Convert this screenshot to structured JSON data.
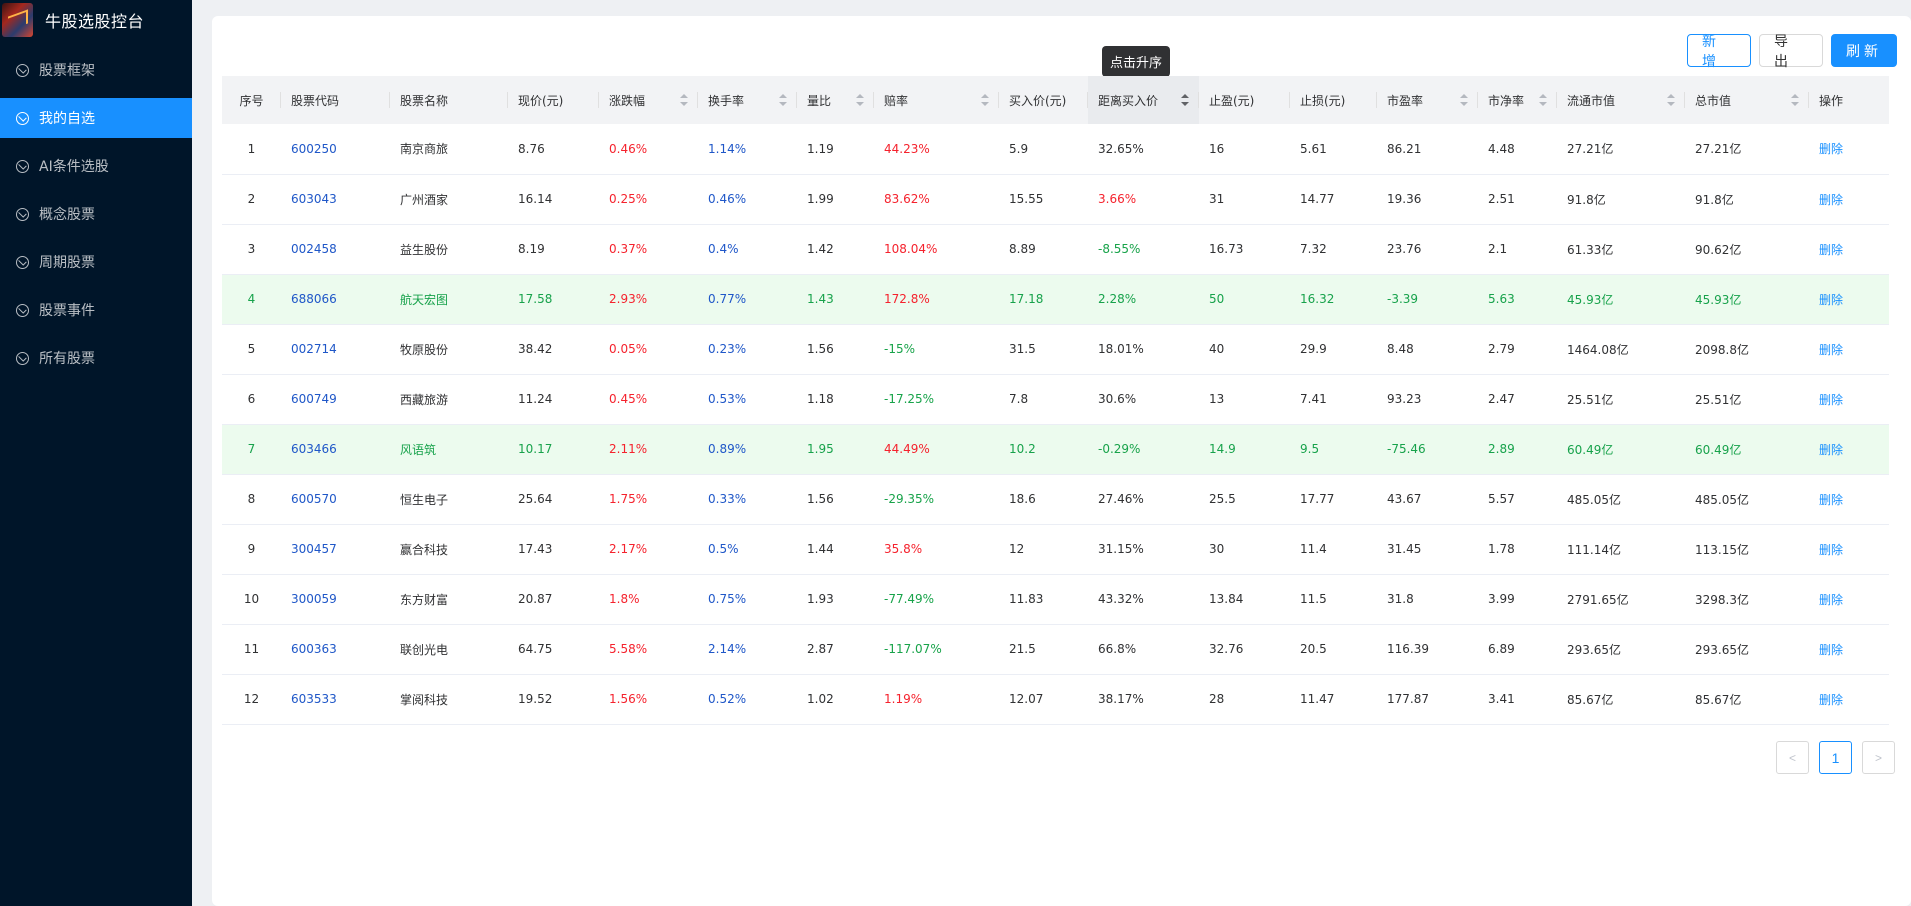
{
  "app": {
    "title": "牛股选股控台"
  },
  "sidebar": {
    "items": [
      {
        "label": "股票框架",
        "active": false
      },
      {
        "label": "我的自选",
        "active": true
      },
      {
        "label": "AI条件选股",
        "active": false
      },
      {
        "label": "概念股票",
        "active": false
      },
      {
        "label": "周期股票",
        "active": false
      },
      {
        "label": "股票事件",
        "active": false
      },
      {
        "label": "所有股票",
        "active": false
      }
    ]
  },
  "toolbar": {
    "add_label": "新增",
    "export_label": "导出",
    "refresh_label": "刷新"
  },
  "tooltip": {
    "text": "点击升序"
  },
  "colors": {
    "accent": "#1890ff",
    "sidebar_bg": "#001529",
    "rise": "#f5222d",
    "fall": "#18a34a",
    "link": "#1f57c8",
    "highlight_row": "#ecfbee"
  },
  "table": {
    "columns": [
      {
        "label": "序号",
        "sortable": false
      },
      {
        "label": "股票代码",
        "sortable": false
      },
      {
        "label": "股票名称",
        "sortable": false
      },
      {
        "label": "现价(元)",
        "sortable": false
      },
      {
        "label": "涨跌幅",
        "sortable": true
      },
      {
        "label": "换手率",
        "sortable": true
      },
      {
        "label": "量比",
        "sortable": true
      },
      {
        "label": "赔率",
        "sortable": true
      },
      {
        "label": "买入价(元)",
        "sortable": false
      },
      {
        "label": "距离买入价",
        "sortable": true
      },
      {
        "label": "止盈(元)",
        "sortable": false
      },
      {
        "label": "止损(元)",
        "sortable": false
      },
      {
        "label": "市盈率",
        "sortable": true
      },
      {
        "label": "市净率",
        "sortable": true
      },
      {
        "label": "流通市值",
        "sortable": true
      },
      {
        "label": "总市值",
        "sortable": true
      },
      {
        "label": "操作",
        "sortable": false
      }
    ],
    "action_label": "删除",
    "rows": [
      {
        "idx": "1",
        "code": "600250",
        "name": "南京商旅",
        "price": "8.76",
        "change": "0.46%",
        "turnover": "1.14%",
        "vol_ratio": "1.19",
        "odds": "44.23%",
        "buy": "5.9",
        "dist": "32.65%",
        "tp": "16",
        "sl": "5.61",
        "pe": "86.21",
        "pb": "4.48",
        "float_cap": "27.21亿",
        "total_cap": "27.21亿",
        "highlight": false
      },
      {
        "idx": "2",
        "code": "603043",
        "name": "广州酒家",
        "price": "16.14",
        "change": "0.25%",
        "turnover": "0.46%",
        "vol_ratio": "1.99",
        "odds": "83.62%",
        "buy": "15.55",
        "dist": "3.66%",
        "tp": "31",
        "sl": "14.77",
        "pe": "19.36",
        "pb": "2.51",
        "float_cap": "91.8亿",
        "total_cap": "91.8亿",
        "highlight": false
      },
      {
        "idx": "3",
        "code": "002458",
        "name": "益生股份",
        "price": "8.19",
        "change": "0.37%",
        "turnover": "0.4%",
        "vol_ratio": "1.42",
        "odds": "108.04%",
        "buy": "8.89",
        "dist": "-8.55%",
        "tp": "16.73",
        "sl": "7.32",
        "pe": "23.76",
        "pb": "2.1",
        "float_cap": "61.33亿",
        "total_cap": "90.62亿",
        "highlight": false
      },
      {
        "idx": "4",
        "code": "688066",
        "name": "航天宏图",
        "price": "17.58",
        "change": "2.93%",
        "turnover": "0.77%",
        "vol_ratio": "1.43",
        "odds": "172.8%",
        "buy": "17.18",
        "dist": "2.28%",
        "tp": "50",
        "sl": "16.32",
        "pe": "-3.39",
        "pb": "5.63",
        "float_cap": "45.93亿",
        "total_cap": "45.93亿",
        "highlight": true
      },
      {
        "idx": "5",
        "code": "002714",
        "name": "牧原股份",
        "price": "38.42",
        "change": "0.05%",
        "turnover": "0.23%",
        "vol_ratio": "1.56",
        "odds": "-15%",
        "buy": "31.5",
        "dist": "18.01%",
        "tp": "40",
        "sl": "29.9",
        "pe": "8.48",
        "pb": "2.79",
        "float_cap": "1464.08亿",
        "total_cap": "2098.8亿",
        "highlight": false
      },
      {
        "idx": "6",
        "code": "600749",
        "name": "西藏旅游",
        "price": "11.24",
        "change": "0.45%",
        "turnover": "0.53%",
        "vol_ratio": "1.18",
        "odds": "-17.25%",
        "buy": "7.8",
        "dist": "30.6%",
        "tp": "13",
        "sl": "7.41",
        "pe": "93.23",
        "pb": "2.47",
        "float_cap": "25.51亿",
        "total_cap": "25.51亿",
        "highlight": false
      },
      {
        "idx": "7",
        "code": "603466",
        "name": "风语筑",
        "price": "10.17",
        "change": "2.11%",
        "turnover": "0.89%",
        "vol_ratio": "1.95",
        "odds": "44.49%",
        "buy": "10.2",
        "dist": "-0.29%",
        "tp": "14.9",
        "sl": "9.5",
        "pe": "-75.46",
        "pb": "2.89",
        "float_cap": "60.49亿",
        "total_cap": "60.49亿",
        "highlight": true
      },
      {
        "idx": "8",
        "code": "600570",
        "name": "恒生电子",
        "price": "25.64",
        "change": "1.75%",
        "turnover": "0.33%",
        "vol_ratio": "1.56",
        "odds": "-29.35%",
        "buy": "18.6",
        "dist": "27.46%",
        "tp": "25.5",
        "sl": "17.77",
        "pe": "43.67",
        "pb": "5.57",
        "float_cap": "485.05亿",
        "total_cap": "485.05亿",
        "highlight": false
      },
      {
        "idx": "9",
        "code": "300457",
        "name": "赢合科技",
        "price": "17.43",
        "change": "2.17%",
        "turnover": "0.5%",
        "vol_ratio": "1.44",
        "odds": "35.8%",
        "buy": "12",
        "dist": "31.15%",
        "tp": "30",
        "sl": "11.4",
        "pe": "31.45",
        "pb": "1.78",
        "float_cap": "111.14亿",
        "total_cap": "113.15亿",
        "highlight": false
      },
      {
        "idx": "10",
        "code": "300059",
        "name": "东方财富",
        "price": "20.87",
        "change": "1.8%",
        "turnover": "0.75%",
        "vol_ratio": "1.93",
        "odds": "-77.49%",
        "buy": "11.83",
        "dist": "43.32%",
        "tp": "13.84",
        "sl": "11.5",
        "pe": "31.8",
        "pb": "3.99",
        "float_cap": "2791.65亿",
        "total_cap": "3298.3亿",
        "highlight": false
      },
      {
        "idx": "11",
        "code": "600363",
        "name": "联创光电",
        "price": "64.75",
        "change": "5.58%",
        "turnover": "2.14%",
        "vol_ratio": "2.87",
        "odds": "-117.07%",
        "buy": "21.5",
        "dist": "66.8%",
        "tp": "32.76",
        "sl": "20.5",
        "pe": "116.39",
        "pb": "6.89",
        "float_cap": "293.65亿",
        "total_cap": "293.65亿",
        "highlight": false
      },
      {
        "idx": "12",
        "code": "603533",
        "name": "掌阅科技",
        "price": "19.52",
        "change": "1.56%",
        "turnover": "0.52%",
        "vol_ratio": "1.02",
        "odds": "1.19%",
        "buy": "12.07",
        "dist": "38.17%",
        "tp": "28",
        "sl": "11.47",
        "pe": "177.87",
        "pb": "3.41",
        "float_cap": "85.67亿",
        "total_cap": "85.67亿",
        "highlight": false
      }
    ]
  },
  "pagination": {
    "current": "1",
    "prev_icon": "chevron-left-icon",
    "next_icon": "chevron-right-icon"
  }
}
